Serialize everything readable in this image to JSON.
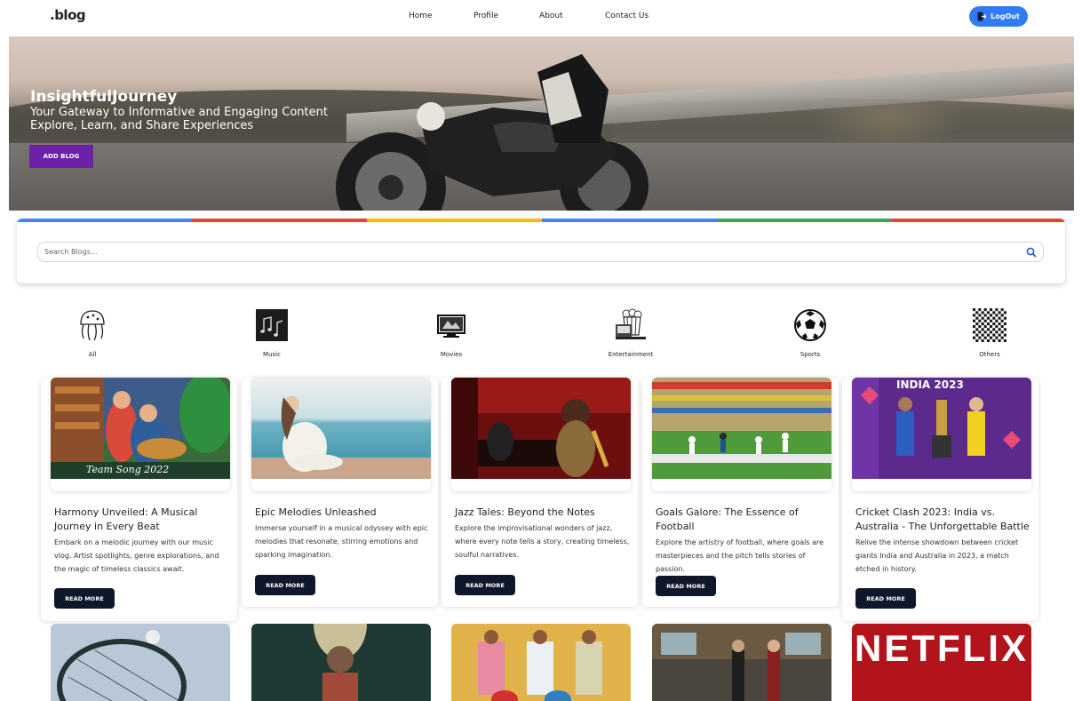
{
  "nav": {
    "logo": ".blog",
    "links": [
      "Home",
      "Profile",
      "About",
      "Contact Us"
    ],
    "logout_label": "LogOut"
  },
  "hero": {
    "title": "InsightfulJourney",
    "subtitle_line1": "Your Gateway to Informative and Engaging Content",
    "subtitle_line2": "Explore, Learn, and Share Experiences",
    "button_label": "ADD BLOG"
  },
  "search": {
    "placeholder": "Search Blogs..."
  },
  "accent_colors": [
    "#4285f4",
    "#ea4335",
    "#fbbc05",
    "#4285f4",
    "#34a853",
    "#ea4335"
  ],
  "categories": [
    {
      "label": "All",
      "icon": "jellyfish-icon"
    },
    {
      "label": "Music",
      "icon": "music-notes-icon"
    },
    {
      "label": "Movies",
      "icon": "monitor-icon"
    },
    {
      "label": "Entertainment",
      "icon": "popcorn-icon"
    },
    {
      "label": "Sports",
      "icon": "soccer-ball-icon"
    },
    {
      "label": "Others",
      "icon": "checker-icon"
    }
  ],
  "cards": [
    {
      "title": "Harmony Unveiled: A Musical Journey in Every Beat",
      "desc": "Embark on a melodic journey with our music vlog. Artist spotlights, genre explorations, and the magic of timeless classics await.",
      "button": "READ MORE",
      "image_caption": "Team Song 2022"
    },
    {
      "title": "Epic Melodies Unleashed",
      "desc": "Immerse yourself in a musical odyssey with epic melodies that resonate, stirring emotions and sparking imagination.",
      "button": "READ MORE"
    },
    {
      "title": "Jazz Tales: Beyond the Notes",
      "desc": "Explore the improvisational wonders of jazz, where every note tells a story, creating timeless, soulful narratives.",
      "button": "READ MORE"
    },
    {
      "title": "Goals Galore: The Essence of Football",
      "desc": "Explore the artistry of football, where goals are masterpieces and the pitch tells stories of passion.",
      "button": "READ MORE"
    },
    {
      "title": "Cricket Clash 2023: India vs. Australia - The Unforgettable Battle",
      "desc": "Relive the intense showdown between cricket giants India and Australia in 2023, a match etched in history.",
      "button": "READ MORE",
      "image_caption": "INDIA 2023"
    }
  ],
  "second_row": {
    "netflix_label": "NETFLIX"
  }
}
